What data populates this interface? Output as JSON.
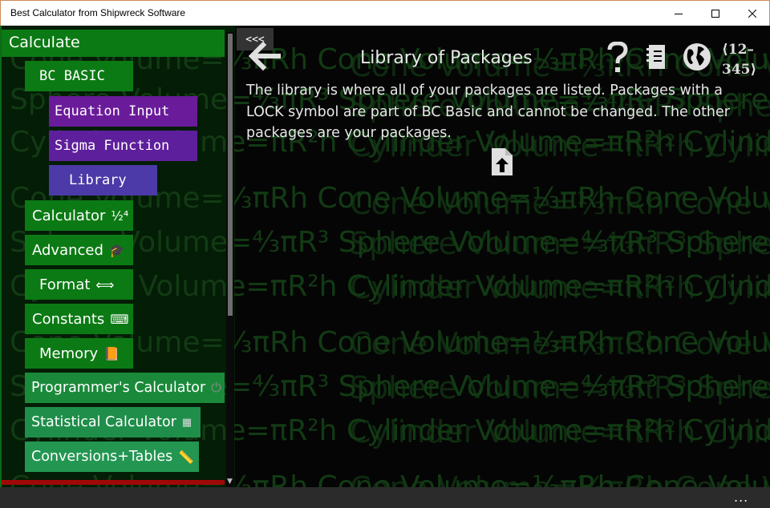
{
  "window": {
    "title": "Best Calculator from Shipwreck Software"
  },
  "watermark": {
    "lines": [
      "Cone Volume=⅓πRh    Cone Volume=⅓πRh    Cone Volume=⅓πRh",
      "Sphere Volume=⁴⁄₃πR³    Sphere Volume=⁴⁄₃πR³    Sphere Volume=⁴⁄₃πR³",
      "Cylinder Volume=πR²h    Cylinder Volume=πR²h    Cylinder Volume=πR²h"
    ]
  },
  "sidebar": {
    "header": "Calculate",
    "items": [
      {
        "label": "BC BASIC",
        "icon": "",
        "bg": "#0c7a14"
      },
      {
        "label": "Equation Input",
        "icon": "",
        "bg": "#6a1b9a"
      },
      {
        "label": "Sigma Function",
        "icon": "",
        "bg": "#5e1f9c"
      },
      {
        "label": "Library",
        "icon": "",
        "bg": "#4b3aa7"
      },
      {
        "label": "Calculator",
        "icon": "½⁴",
        "bg": "#0c7a14"
      },
      {
        "label": "Advanced",
        "icon": "🎓",
        "bg": "#0c7a14"
      },
      {
        "label": "Format",
        "icon": "⟺",
        "bg": "#0c7a14"
      },
      {
        "label": "Constants",
        "icon": "⌨",
        "bg": "#0c7a14"
      },
      {
        "label": "Memory",
        "icon": "📙",
        "bg": "#0c7a14"
      },
      {
        "label": "Programmer's Calculator",
        "icon": "⏻",
        "bg": "#1a8a3a"
      },
      {
        "label": "Statistical Calculator",
        "icon": "▦",
        "bg": "#1f8e4a"
      },
      {
        "label": "Conversions+Tables",
        "icon": "📏",
        "bg": "#239651"
      }
    ],
    "collapse_label": "<<<"
  },
  "main": {
    "title": "Library of Packages",
    "description": "The library is where all of your packages are listed. Packages with a LOCK symbol are part of BC Basic and cannot be changed. The other packages are your packages.",
    "page_indicator_line1": "⟨12–",
    "page_indicator_line2": "345⟩",
    "toolbar_icons": [
      "help-icon",
      "notebook-icon",
      "globe-icon"
    ]
  },
  "bottombar": {
    "more_label": "..."
  }
}
